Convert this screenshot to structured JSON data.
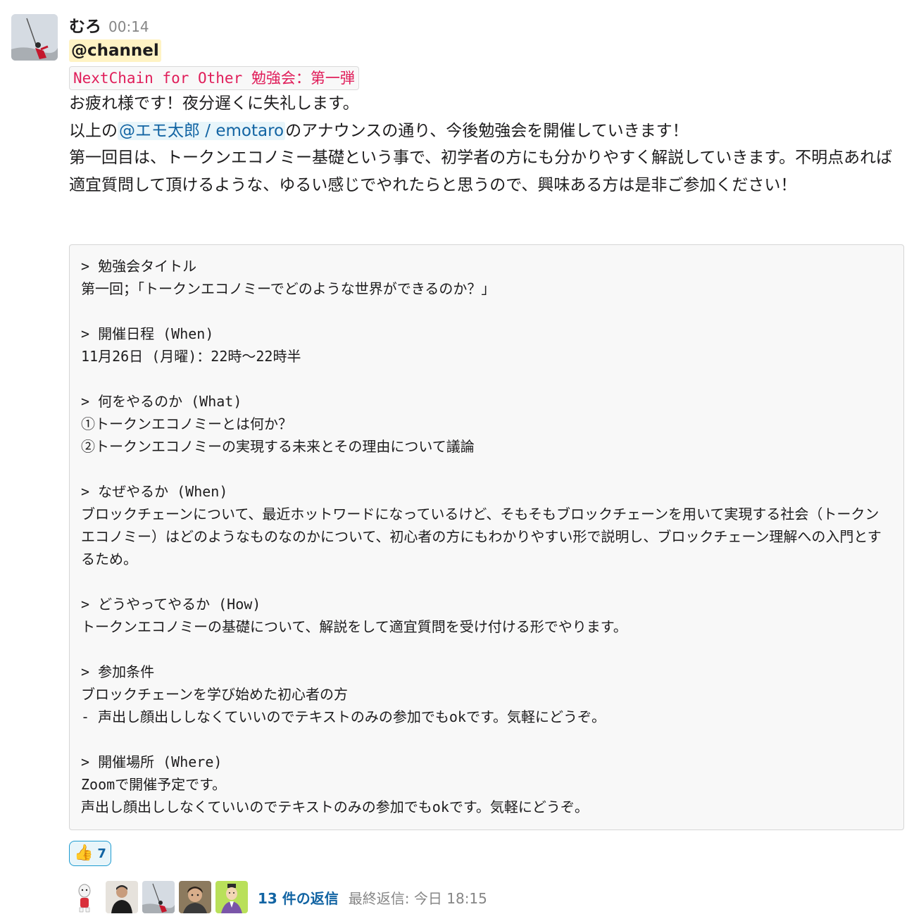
{
  "message": {
    "author": "むろ",
    "time": "00:14",
    "channel_mention": "@channel",
    "inline_code": "NextChain for Other 勉強会：第一弾",
    "line1": "お疲れ様です！夜分遅くに失礼します。",
    "line2_before": "以上の",
    "line2_mention": "@エモ太郎 / emotaro",
    "line2_after": "のアナウンスの通り、今後勉強会を開催していきます！",
    "line3": "第一回目は、トークンエコノミー基礎という事で、初学者の方にも分かりやすく解説していきます。不明点あれば適宜質問して頂けるような、ゆるい感じでやれたらと思うので、興味ある方は是非ご参加ください！",
    "code_block": "> 勉強会タイトル\n第一回；「トークンエコノミーでどのような世界ができるのか？」\n\n> 開催日程 (When)\n11月26日 (月曜)：22時〜22時半\n\n> 何をやるのか (What)\n①トークンエコノミーとは何か？\n②トークンエコノミーの実現する未来とその理由について議論\n\n> なぜやるか (When)\nブロックチェーンについて、最近ホットワードになっているけど、そもそもブロックチェーンを用いて実現する社会（トークンエコノミー）はどのようなものなのかについて、初心者の方にもわかりやすい形で説明し、ブロックチェーン理解への入門とするため。\n\n> どうやってやるか (How)\nトークンエコノミーの基礎について、解説をして適宜質問を受け付ける形でやります。\n\n> 参加条件\nブロックチェーンを学び始めた初心者の方\n- 声出し顔出ししなくていいのでテキストのみの参加でもokです。気軽にどうぞ。\n\n> 開催場所 (Where)\nZoomで開催予定です。\n声出し顔出ししなくていいのでテキストのみの参加でもokです。気軽にどうぞ。"
  },
  "reaction": {
    "emoji": "👍",
    "icon": "thumbs-up-icon",
    "count": "7"
  },
  "thread": {
    "reply_count_label": "13 件の返信",
    "last_reply_label": "最終返信: 今日 18:15"
  },
  "colors": {
    "link": "#1264a3",
    "code_red": "#e01e5a",
    "channel_highlight": "#fff3c4",
    "mention_bg": "#e8f5fa"
  }
}
